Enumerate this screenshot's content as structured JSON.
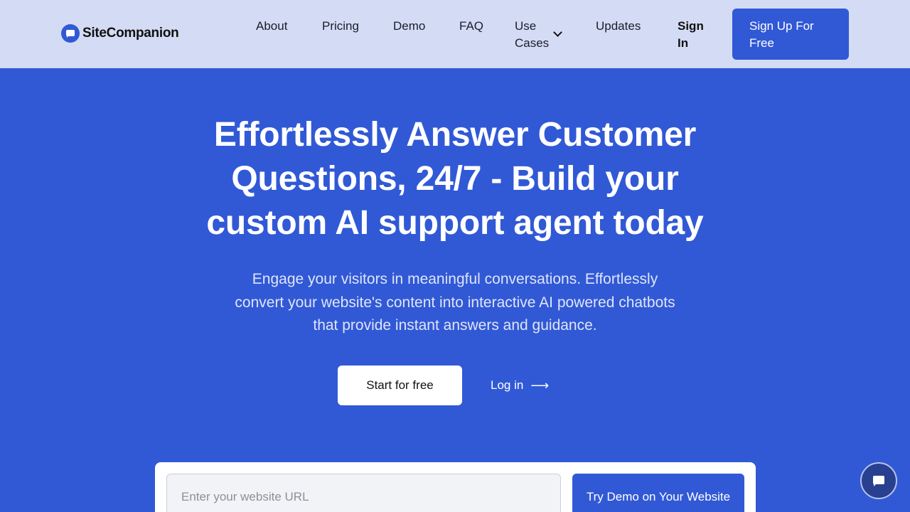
{
  "brand": {
    "name": "SiteCompanion",
    "logo_icon": "chat-bubble-icon"
  },
  "nav": {
    "about": "About",
    "pricing": "Pricing",
    "demo": "Demo",
    "faq": "FAQ",
    "use_cases": "Use Cases",
    "updates": "Updates",
    "sign_in": "Sign In",
    "sign_up": "Sign Up For Free"
  },
  "hero": {
    "title": "Effortlessly Answer Customer Questions, 24/7 - Build your custom AI support agent today",
    "subtitle": "Engage your visitors in meaningful conversations. Effortlessly convert your website's content into interactive AI powered chatbots that provide instant answers and guidance.",
    "start_button": "Start for free",
    "login_link": "Log in",
    "login_arrow": "⟶"
  },
  "demo": {
    "url_placeholder": "Enter your website URL",
    "try_button": "Try Demo on Your Website"
  },
  "colors": {
    "primary": "#3159d6",
    "nav_bg": "#d4dcf5",
    "chat_fab": "#28408f"
  }
}
